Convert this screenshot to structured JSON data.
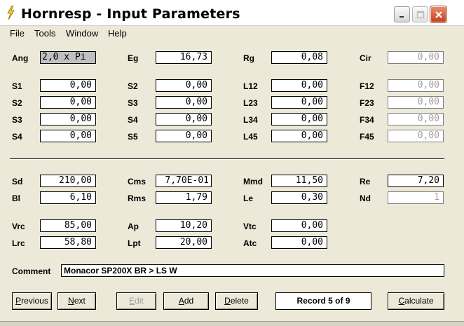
{
  "window": {
    "title": "Hornresp - Input Parameters"
  },
  "menu": {
    "items": [
      "File",
      "Tools",
      "Window",
      "Help"
    ]
  },
  "params": {
    "ang": {
      "label": "Ang",
      "value": "2,0 x Pi"
    },
    "eg": {
      "label": "Eg",
      "value": "16,73"
    },
    "rg": {
      "label": "Rg",
      "value": "0,08"
    },
    "cir": {
      "label": "Cir",
      "value": "0,00"
    },
    "s1": {
      "label": "S1",
      "value": "0,00"
    },
    "s2b": {
      "label": "S2",
      "value": "0,00"
    },
    "l12": {
      "label": "L12",
      "value": "0,00"
    },
    "f12": {
      "label": "F12",
      "value": "0,00"
    },
    "s2": {
      "label": "S2",
      "value": "0,00"
    },
    "s3b": {
      "label": "S3",
      "value": "0,00"
    },
    "l23": {
      "label": "L23",
      "value": "0,00"
    },
    "f23": {
      "label": "F23",
      "value": "0,00"
    },
    "s3": {
      "label": "S3",
      "value": "0,00"
    },
    "s4b": {
      "label": "S4",
      "value": "0,00"
    },
    "l34": {
      "label": "L34",
      "value": "0,00"
    },
    "f34": {
      "label": "F34",
      "value": "0,00"
    },
    "s4": {
      "label": "S4",
      "value": "0,00"
    },
    "s5": {
      "label": "S5",
      "value": "0,00"
    },
    "l45": {
      "label": "L45",
      "value": "0,00"
    },
    "f45": {
      "label": "F45",
      "value": "0,00"
    },
    "sd": {
      "label": "Sd",
      "value": "210,00"
    },
    "cms": {
      "label": "Cms",
      "value": "7,70E-01"
    },
    "mmd": {
      "label": "Mmd",
      "value": "11,50"
    },
    "re": {
      "label": "Re",
      "value": "7,20"
    },
    "bl": {
      "label": "Bl",
      "value": "6,10"
    },
    "rms": {
      "label": "Rms",
      "value": "1,79"
    },
    "le": {
      "label": "Le",
      "value": "0,30"
    },
    "nd": {
      "label": "Nd",
      "value": "1"
    },
    "vrc": {
      "label": "Vrc",
      "value": "85,00"
    },
    "ap": {
      "label": "Ap",
      "value": "10,20"
    },
    "vtc": {
      "label": "Vtc",
      "value": "0,00"
    },
    "lrc": {
      "label": "Lrc",
      "value": "58,80"
    },
    "lpt": {
      "label": "Lpt",
      "value": "20,00"
    },
    "atc": {
      "label": "Atc",
      "value": "0,00"
    }
  },
  "comment": {
    "label": "Comment",
    "value": "Monacor SP200X BR > LS W"
  },
  "buttons": {
    "previous": "Previous",
    "next": "Next",
    "edit": "Edit",
    "add": "Add",
    "delete": "Delete",
    "calculate": "Calculate"
  },
  "record": "Record 5 of 9",
  "colors": {
    "disabled_text": "#a0a0a0",
    "face": "#ece9d8",
    "close_button": "#c8401f"
  }
}
